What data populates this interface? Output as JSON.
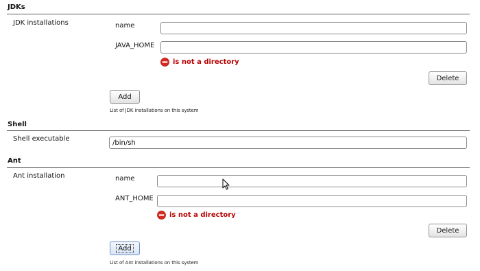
{
  "jdks": {
    "section_title": "JDKs",
    "row_label": "JDK installations",
    "name_label": "name",
    "name_value": "",
    "home_label": "JAVA_HOME",
    "home_value": "",
    "error_text": "is not a directory",
    "delete_label": "Delete",
    "add_label": "Add",
    "help_text": "List of JDK installations on this system"
  },
  "shell": {
    "section_title": "Shell",
    "row_label": "Shell executable",
    "executable_value": "/bin/sh"
  },
  "ant": {
    "section_title": "Ant",
    "row_label": "Ant installation",
    "name_label": "name",
    "name_value": "",
    "home_label": "ANT_HOME",
    "home_value": "",
    "error_text": "is not a directory",
    "delete_label": "Delete",
    "add_label": "Add",
    "help_text": "List of Ant installations on this system"
  },
  "icons": {
    "error": "error-circle-minus-icon",
    "cursor": "mouse-pointer-icon"
  },
  "colors": {
    "error_text": "#b80000",
    "error_icon": "#d9281f",
    "rule": "#5a5a5a"
  }
}
